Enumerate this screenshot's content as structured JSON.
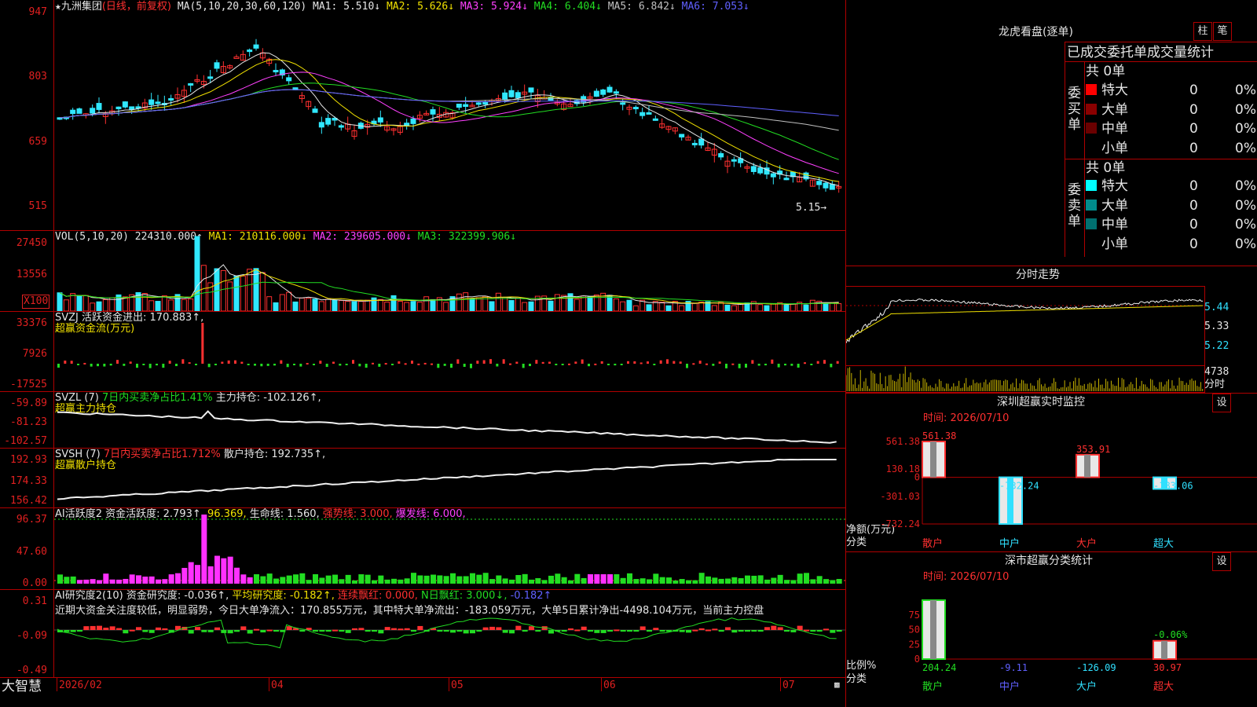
{
  "main": {
    "star": "★",
    "stock_name": "九洲集团",
    "period": "(日线，前复权)",
    "ma_legend": [
      {
        "text": "MA(5,10,20,30,60,120)",
        "color": "#e6e6e6"
      },
      {
        "text": "MA1: 5.510↓",
        "color": "#e6e6e6"
      },
      {
        "text": "MA2: 5.626↓",
        "color": "#f0e000"
      },
      {
        "text": "MA3: 5.924↓",
        "color": "#ff40ff"
      },
      {
        "text": "MA4: 6.404↓",
        "color": "#22dd22"
      },
      {
        "text": "MA5: 6.842↓",
        "color": "#c0c0c0"
      },
      {
        "text": "MA6: 7.053↓",
        "color": "#6060ff"
      }
    ],
    "y_ticks": [
      "947",
      "803",
      "659",
      "515"
    ],
    "last_price_label": "5.15→"
  },
  "vol": {
    "legend": [
      {
        "text": "VOL(5,10,20)",
        "color": "#e6e6e6"
      },
      {
        "text": "224310.000↑",
        "color": "#e6e6e6"
      },
      {
        "text": "MA1: 210116.000↓",
        "color": "#f0e000"
      },
      {
        "text": "MA2: 239605.000↓",
        "color": "#ff40ff"
      },
      {
        "text": "MA3: 322399.906↓",
        "color": "#22dd22"
      }
    ],
    "y_ticks": [
      "27450",
      "13556"
    ],
    "multiplier": "X100"
  },
  "svzj": {
    "line1": "SVZJ  活跃资金进出: 170.883↑,",
    "line2": "超赢资金流(万元)",
    "y_ticks": [
      "33376",
      "7926",
      "-17525"
    ]
  },
  "svzl": {
    "prefix": "SVZL (7)",
    "seg1": "7日内买卖净占比1.41%",
    "seg2": "主力持仓: -102.126↑,",
    "line2": "超赢主力持仓",
    "y_ticks": [
      "-59.89",
      "-81.23",
      "-102.57"
    ]
  },
  "svsh": {
    "prefix": "SVSH (7)",
    "seg1": "7日内买卖净占比1.712%",
    "seg2": "散户持仓: 192.735↑,",
    "line2": "超赢散户持仓",
    "y_ticks": [
      "192.93",
      "174.33",
      "156.42"
    ]
  },
  "ai_active": {
    "legend": [
      {
        "text": "AI活跃度2",
        "color": "#e6e6e6"
      },
      {
        "text": "资金活跃度: 2.793↑,",
        "color": "#e6e6e6"
      },
      {
        "text": "96.369,",
        "color": "#f0e000"
      },
      {
        "text": "生命线: 1.560,",
        "color": "#e6e6e6"
      },
      {
        "text": "强势线: 3.000,",
        "color": "#ff3030"
      },
      {
        "text": "爆发线: 6.000,",
        "color": "#ff40ff"
      }
    ],
    "y_ticks": [
      "96.37",
      "47.60",
      "0.00"
    ]
  },
  "ai_research": {
    "legend": [
      {
        "text": "AI研究度2(10)",
        "color": "#e6e6e6"
      },
      {
        "text": "资金研究度: -0.036↑,",
        "color": "#e6e6e6"
      },
      {
        "text": "平均研究度: -0.182↑,",
        "color": "#f0e000"
      },
      {
        "text": "连续飘红: 0.000,",
        "color": "#ff3030"
      },
      {
        "text": "N日飘红: 3.000↓,",
        "color": "#22dd22"
      },
      {
        "text": "-0.182↑",
        "color": "#6060ff"
      }
    ],
    "comment": "近期大资金关注度较低，明显弱势，今日大单净流入：170.855万元，其中特大单净流出：-183.059万元，大单5日累计净出-4498.104万元，当前主力控盘",
    "y_ticks": [
      "0.31",
      "-0.09",
      "-0.49"
    ]
  },
  "x_axis": {
    "labels": [
      "2026/02",
      "04",
      "05",
      "06",
      "07"
    ],
    "brand": "大智慧"
  },
  "dragon_tiger": {
    "title": "龙虎看盘(逐单)",
    "tab_zhu": "柱",
    "tab_bi": "笔",
    "header": "已成交委托单成交量统计",
    "buy_side": {
      "label": "委买单",
      "total": "共 0单",
      "rows": [
        {
          "name": "特大",
          "count": "0",
          "pct": "0%",
          "color": "#ff0000"
        },
        {
          "name": "大单",
          "count": "0",
          "pct": "0%",
          "color": "#8b0000"
        },
        {
          "name": "中单",
          "count": "0",
          "pct": "0%",
          "color": "#6a0000"
        },
        {
          "name": "小单",
          "count": "0",
          "pct": "0%",
          "color": ""
        }
      ]
    },
    "sell_side": {
      "label": "委卖单",
      "total": "共 0单",
      "rows": [
        {
          "name": "特大",
          "count": "0",
          "pct": "0%",
          "color": "#00ffff"
        },
        {
          "name": "大单",
          "count": "0",
          "pct": "0%",
          "color": "#008b8b"
        },
        {
          "name": "中单",
          "count": "0",
          "pct": "0%",
          "color": "#007070"
        },
        {
          "name": "小单",
          "count": "0",
          "pct": "0%",
          "color": ""
        }
      ]
    }
  },
  "intraday": {
    "title": "分时走势",
    "y_ticks": [
      "5.44",
      "5.33",
      "5.22"
    ],
    "vol_tick": "4738",
    "vol_label": "分时"
  },
  "monitor": {
    "title": "深圳超赢实时监控",
    "settings": "设",
    "time": "时间: 2026/07/10",
    "y_ticks": [
      "561.38",
      "130.18",
      "0",
      "-301.03",
      "-732.24"
    ],
    "unit_label": "净额(万元)",
    "cat_label": "分类",
    "chart_data": {
      "type": "bar",
      "categories": [
        "散户",
        "中户",
        "大户",
        "超大"
      ],
      "values": [
        561.38,
        -732.24,
        353.91,
        -183.06
      ],
      "value_labels": [
        "561.38",
        "-732.24",
        "353.91",
        "-183.06"
      ],
      "ylim": [
        -732.24,
        561.38
      ]
    }
  },
  "classify": {
    "title": "深市超赢分类统计",
    "settings": "设",
    "time": "时间: 2026/07/10",
    "y_ticks": [
      "75",
      "50",
      "25",
      "0"
    ],
    "ratio_label": "比例%",
    "cat_label": "分类",
    "chart_data": {
      "type": "bar",
      "categories": [
        "散户",
        "中户",
        "大户",
        "超大"
      ],
      "values": [
        204.24,
        -9.11,
        -126.09,
        30.97
      ],
      "value_labels": [
        "204.24",
        "-9.11",
        "-126.09",
        "30.97"
      ],
      "annotation": "-0.06%",
      "ylim": [
        0,
        100
      ]
    }
  }
}
